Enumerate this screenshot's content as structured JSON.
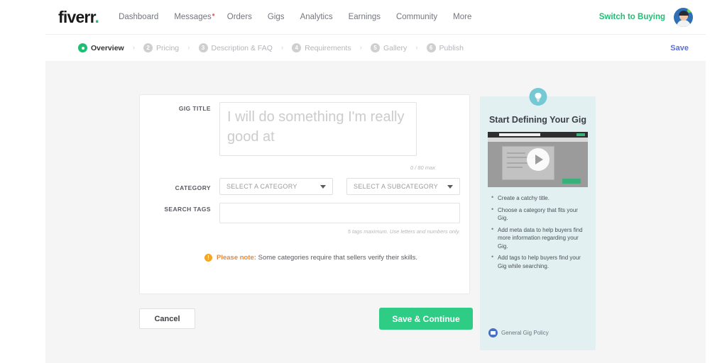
{
  "brand": {
    "name": "fiverr",
    "accent": "#1dbf73"
  },
  "topnav": {
    "links": [
      {
        "label": "Dashboard",
        "badge": ""
      },
      {
        "label": "Messages",
        "badge": "•"
      },
      {
        "label": "Orders",
        "badge": ""
      },
      {
        "label": "Gigs",
        "badge": ""
      },
      {
        "label": "Analytics",
        "badge": ""
      },
      {
        "label": "Earnings",
        "badge": ""
      },
      {
        "label": "Community",
        "badge": ""
      },
      {
        "label": "More",
        "badge": ""
      }
    ],
    "switch_label": "Switch to Buying"
  },
  "steps": {
    "items": [
      {
        "num": "",
        "label": "Overview"
      },
      {
        "num": "2",
        "label": "Pricing"
      },
      {
        "num": "3",
        "label": "Description & FAQ"
      },
      {
        "num": "4",
        "label": "Requirements"
      },
      {
        "num": "5",
        "label": "Gallery"
      },
      {
        "num": "6",
        "label": "Publish"
      }
    ],
    "separator": "›",
    "save_label": "Save"
  },
  "form": {
    "gig_title_label": "GIG TITLE",
    "gig_title_value": "",
    "gig_title_placeholder": "I will do something I'm really good at",
    "gig_title_counter": "0 / 80 max",
    "category_label": "CATEGORY",
    "category_value": "SELECT A CATEGORY",
    "subcategory_value": "SELECT A SUBCATEGORY",
    "search_tags_label": "SEARCH TAGS",
    "search_tags_value": "",
    "search_tags_placeholder": "",
    "search_tags_hint": "5 tags maximum. Use letters and numbers only.",
    "note_prefix": "Please note:",
    "note_text": " Some categories require that sellers verify their skills.",
    "note_icon_glyph": "!"
  },
  "tips": {
    "title": "Start Defining Your Gig",
    "bullets": [
      "Create a catchy title.",
      "Choose a category that fits your Gig.",
      "Add meta data to help buyers find more information regarding your Gig.",
      "Add tags to help buyers find your Gig while searching."
    ],
    "policy_label": "General Gig Policy"
  },
  "footer": {
    "cancel_label": "Cancel",
    "save_continue_label": "Save & Continue"
  }
}
